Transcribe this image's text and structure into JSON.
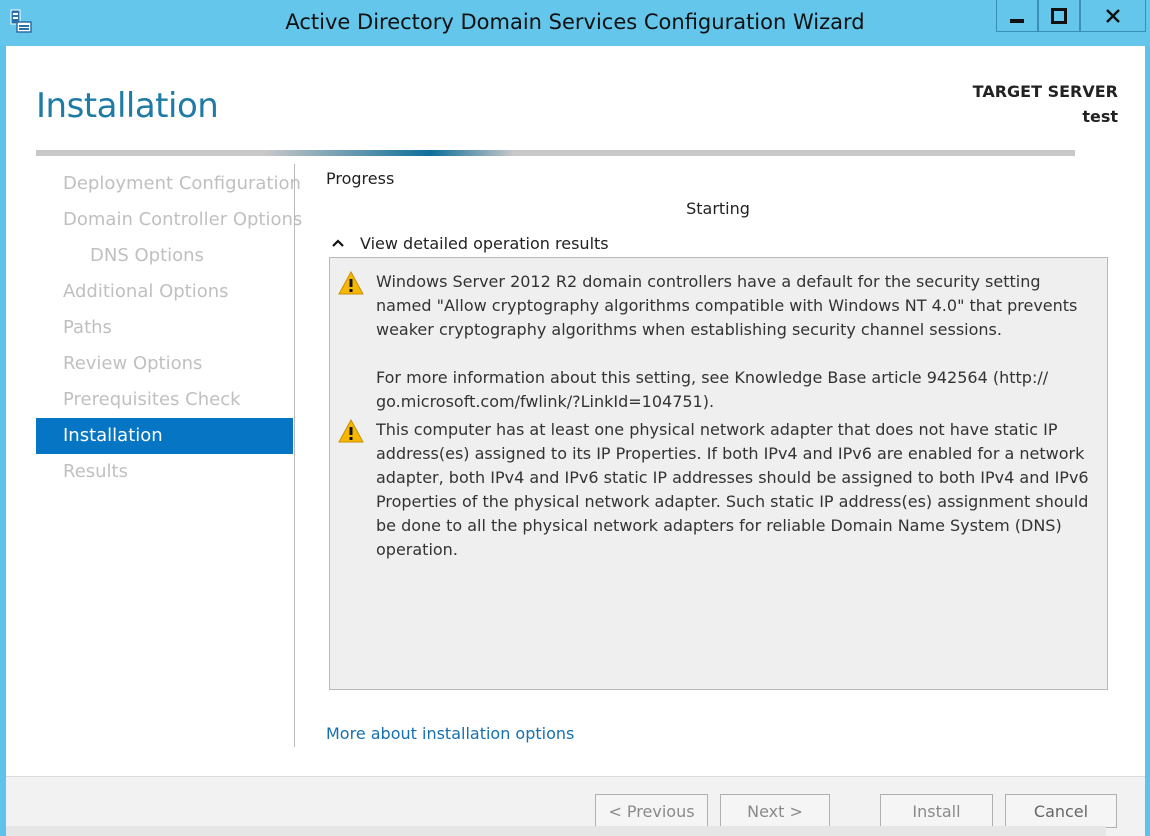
{
  "window": {
    "title": "Active Directory Domain Services Configuration Wizard",
    "icons": {
      "app": "server-wizard-icon",
      "minimize": "minimize-icon",
      "maximize": "maximize-icon",
      "close": "close-icon"
    }
  },
  "header": {
    "page_title": "Installation",
    "target_label": "TARGET SERVER",
    "target_name": "test"
  },
  "nav": {
    "items": [
      {
        "label": "Deployment Configuration",
        "state": "disabled"
      },
      {
        "label": "Domain Controller Options",
        "state": "disabled"
      },
      {
        "label": "DNS Options",
        "state": "disabled",
        "sub": true
      },
      {
        "label": "Additional Options",
        "state": "disabled"
      },
      {
        "label": "Paths",
        "state": "disabled"
      },
      {
        "label": "Review Options",
        "state": "disabled"
      },
      {
        "label": "Prerequisites Check",
        "state": "disabled"
      },
      {
        "label": "Installation",
        "state": "active"
      },
      {
        "label": "Results",
        "state": "disabled"
      }
    ]
  },
  "main": {
    "progress_label": "Progress",
    "status": "Starting",
    "details_toggle": "View detailed operation results",
    "messages": [
      {
        "icon": "warning-icon",
        "paragraphs": [
          "Windows Server 2012 R2 domain controllers have a default for the security setting named \"Allow cryptography algorithms compatible with Windows NT 4.0\" that prevents weaker cryptography algorithms when establishing security channel sessions.",
          "For more information about this setting, see Knowledge Base article 942564 (http:// go.microsoft.com/fwlink/?LinkId=104751)."
        ]
      },
      {
        "icon": "warning-icon",
        "paragraphs": [
          "This computer has at least one physical network adapter that does not have static IP address(es) assigned to its IP Properties. If both IPv4 and IPv6 are enabled for a network adapter, both IPv4 and IPv6 static IP addresses should be assigned to both IPv4 and IPv6 Properties of the physical network adapter. Such static IP address(es) assignment should be done to all the physical network adapters for reliable Domain Name System (DNS) operation."
        ]
      }
    ],
    "more_link": "More about installation options"
  },
  "footer": {
    "previous": "< Previous",
    "next": "Next >",
    "install": "Install",
    "cancel": "Cancel"
  },
  "colors": {
    "titlebar": "#63c6ea",
    "accent": "#0575c4",
    "heading": "#1e7ba6",
    "link": "#1670b0",
    "warning": "#f5b700"
  }
}
